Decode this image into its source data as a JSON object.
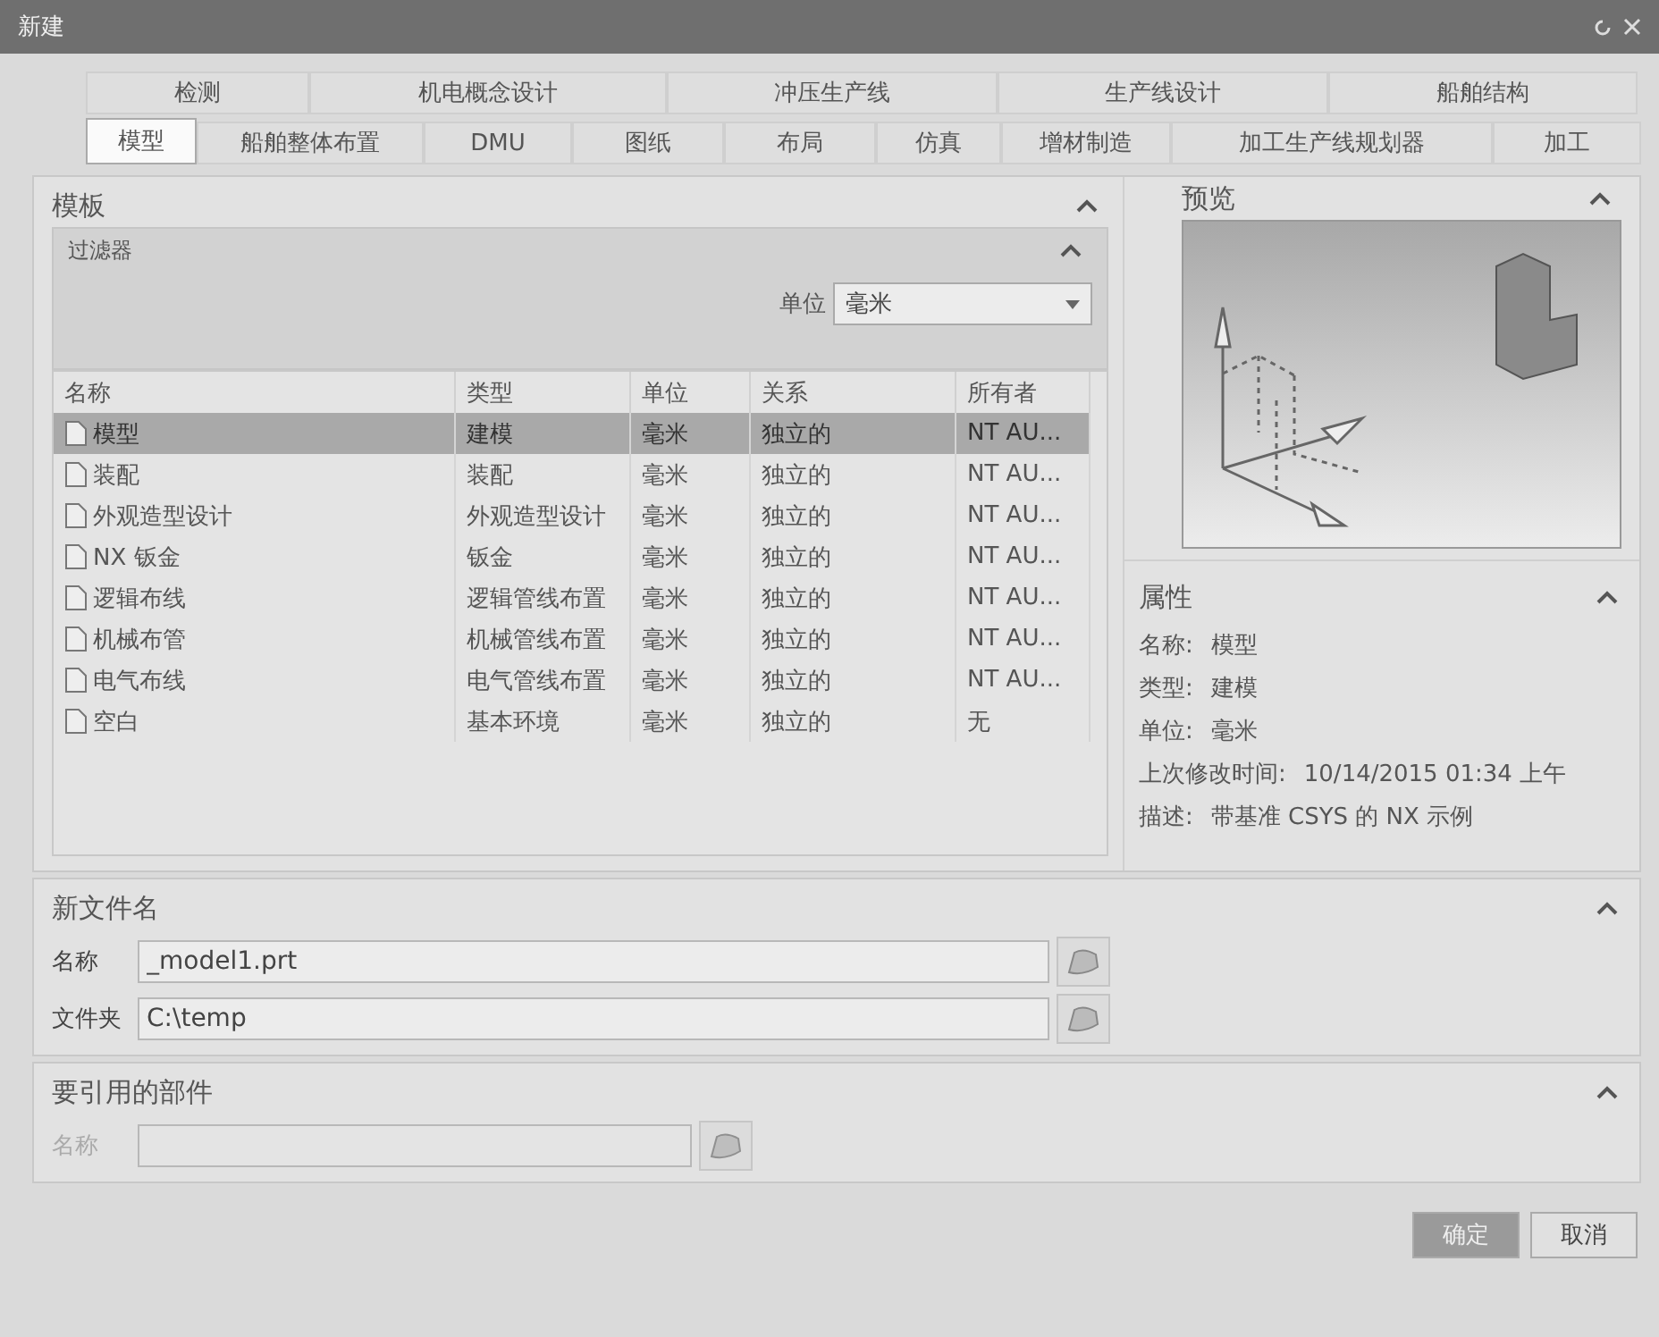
{
  "window": {
    "title": "新建"
  },
  "tab_rows": [
    [
      {
        "label": "检测",
        "selected": false
      },
      {
        "label": "机电概念设计",
        "selected": false
      },
      {
        "label": "冲压生产线",
        "selected": false
      },
      {
        "label": "生产线设计",
        "selected": false
      },
      {
        "label": "船舶结构",
        "selected": false
      }
    ],
    [
      {
        "label": "模型",
        "selected": true
      },
      {
        "label": "船舶整体布置",
        "selected": false
      },
      {
        "label": "DMU",
        "selected": false
      },
      {
        "label": "图纸",
        "selected": false
      },
      {
        "label": "布局",
        "selected": false
      },
      {
        "label": "仿真",
        "selected": false
      },
      {
        "label": "增材制造",
        "selected": false
      },
      {
        "label": "加工生产线规划器",
        "selected": false
      },
      {
        "label": "加工",
        "selected": false
      }
    ]
  ],
  "templates": {
    "title": "模板",
    "expanded": true,
    "filter": {
      "title": "过滤器",
      "expanded": true,
      "unit_label": "单位",
      "unit_value": "毫米"
    },
    "columns": [
      "名称",
      "类型",
      "单位",
      "关系",
      "所有者"
    ],
    "rows": [
      {
        "cells": [
          "模型",
          "建模",
          "毫米",
          "独立的",
          "NT AU..."
        ],
        "selected": true
      },
      {
        "cells": [
          "装配",
          "装配",
          "毫米",
          "独立的",
          "NT AU..."
        ],
        "selected": false
      },
      {
        "cells": [
          "外观造型设计",
          "外观造型设计",
          "毫米",
          "独立的",
          "NT AU..."
        ],
        "selected": false
      },
      {
        "cells": [
          "NX 钣金",
          "钣金",
          "毫米",
          "独立的",
          "NT AU..."
        ],
        "selected": false
      },
      {
        "cells": [
          "逻辑布线",
          "逻辑管线布置",
          "毫米",
          "独立的",
          "NT AU..."
        ],
        "selected": false
      },
      {
        "cells": [
          "机械布管",
          "机械管线布置",
          "毫米",
          "独立的",
          "NT AU..."
        ],
        "selected": false
      },
      {
        "cells": [
          "电气布线",
          "电气管线布置",
          "毫米",
          "独立的",
          "NT AU..."
        ],
        "selected": false
      },
      {
        "cells": [
          "空白",
          "基本环境",
          "毫米",
          "独立的",
          "无"
        ],
        "selected": false
      }
    ]
  },
  "preview": {
    "title": "预览",
    "expanded": true
  },
  "properties": {
    "title": "属性",
    "expanded": true,
    "items": [
      {
        "label": "名称:",
        "value": "模型"
      },
      {
        "label": "类型:",
        "value": "建模"
      },
      {
        "label": "单位:",
        "value": "毫米"
      },
      {
        "label": "上次修改时间:",
        "value": "10/14/2015 01:34 上午"
      },
      {
        "label": "描述:",
        "value": "带基准 CSYS 的 NX 示例"
      }
    ]
  },
  "new_file": {
    "title": "新文件名",
    "expanded": true,
    "fields": [
      {
        "label": "名称",
        "value": "_model1.prt",
        "disabled": false
      },
      {
        "label": "文件夹",
        "value": "C:\\temp",
        "disabled": false
      }
    ]
  },
  "referenced_part": {
    "title": "要引用的部件",
    "expanded": true,
    "fields": [
      {
        "label": "名称",
        "disabled": true
      }
    ]
  },
  "buttons": [
    {
      "label": "确定",
      "default": true
    },
    {
      "label": "取消",
      "default": false
    }
  ]
}
